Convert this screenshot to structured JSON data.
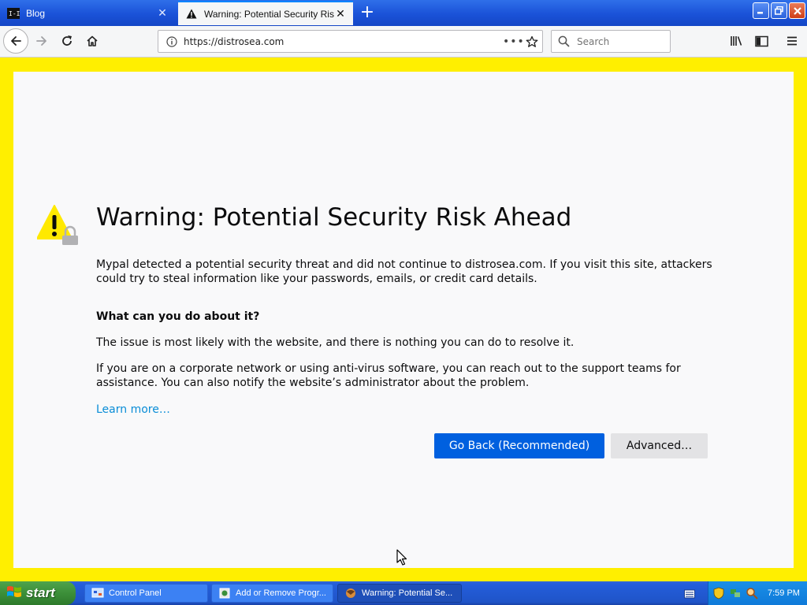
{
  "tabs": [
    {
      "title": "Blog"
    },
    {
      "title": "Warning: Potential Security Risk Ahead"
    }
  ],
  "toolbar": {
    "url": "https://distrosea.com",
    "search_placeholder": "Search",
    "page_actions": "•••"
  },
  "content": {
    "heading": "Warning: Potential Security Risk Ahead",
    "intro": "Mypal detected a potential security threat and did not continue to distrosea.com. If you visit this site, attackers could try to steal information like your passwords, emails, or credit card details.",
    "what_heading": "What can you do about it?",
    "issue": "The issue is most likely with the website, and there is nothing you can do to resolve it.",
    "corporate": "If you are on a corporate network or using anti-virus software, you can reach out to the support teams for assistance. You can also notify the website’s administrator about the problem.",
    "learn_more": "Learn more…",
    "go_back": "Go Back (Recommended)",
    "advanced": "Advanced…"
  },
  "taskbar": {
    "start": "start",
    "tasks": [
      {
        "label": "Control Panel"
      },
      {
        "label": "Add or Remove Progr..."
      },
      {
        "label": "Warning: Potential Se..."
      }
    ],
    "clock": "7:59 PM"
  },
  "colors": {
    "window_frame": "#ffef00",
    "primary_button": "#0060df",
    "link": "#0a8dd7",
    "warning_icon": "#ffe900"
  }
}
